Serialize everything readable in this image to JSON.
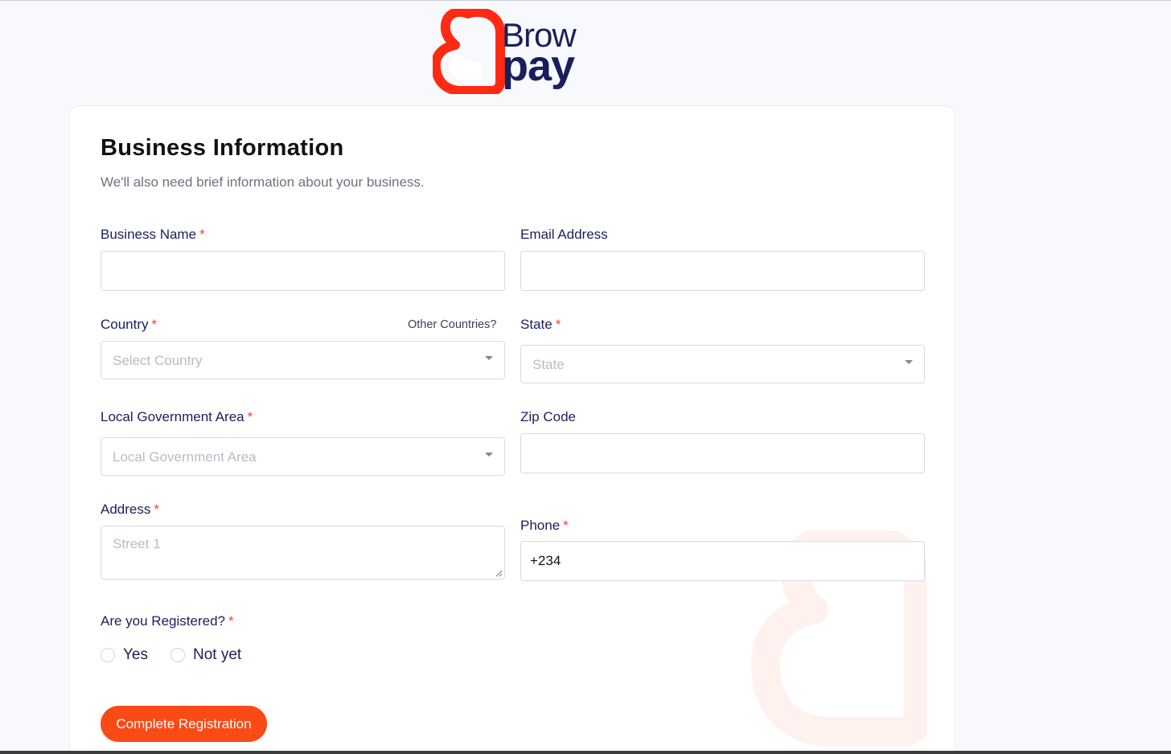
{
  "brand": {
    "line1": "Brow",
    "line2": "pay",
    "accent": "#fa4a16",
    "text_color": "#1a1f5c",
    "logo_icon": "browpay-heart-icon"
  },
  "form": {
    "title": "Business Information",
    "subtitle": "We'll also need brief information about your business.",
    "business_name": {
      "label": "Business Name",
      "value": ""
    },
    "email": {
      "label": "Email Address",
      "value": ""
    },
    "country": {
      "label": "Country",
      "placeholder": "Select Country",
      "other_link": "Other Countries?"
    },
    "state": {
      "label": "State",
      "placeholder": "State"
    },
    "lga": {
      "label": "Local Government Area",
      "placeholder": "Local Government Area"
    },
    "zip": {
      "label": "Zip Code",
      "value": ""
    },
    "address": {
      "label": "Address",
      "placeholder": "Street 1"
    },
    "phone": {
      "label": "Phone",
      "value": "+234"
    },
    "registered": {
      "label": "Are you Registered?",
      "options": [
        "Yes",
        "Not yet"
      ],
      "selected": null
    },
    "submit_label": "Complete Registration"
  },
  "colors": {
    "required": "#f04438",
    "button": "#fa4a16",
    "label": "#1a1f5c"
  }
}
